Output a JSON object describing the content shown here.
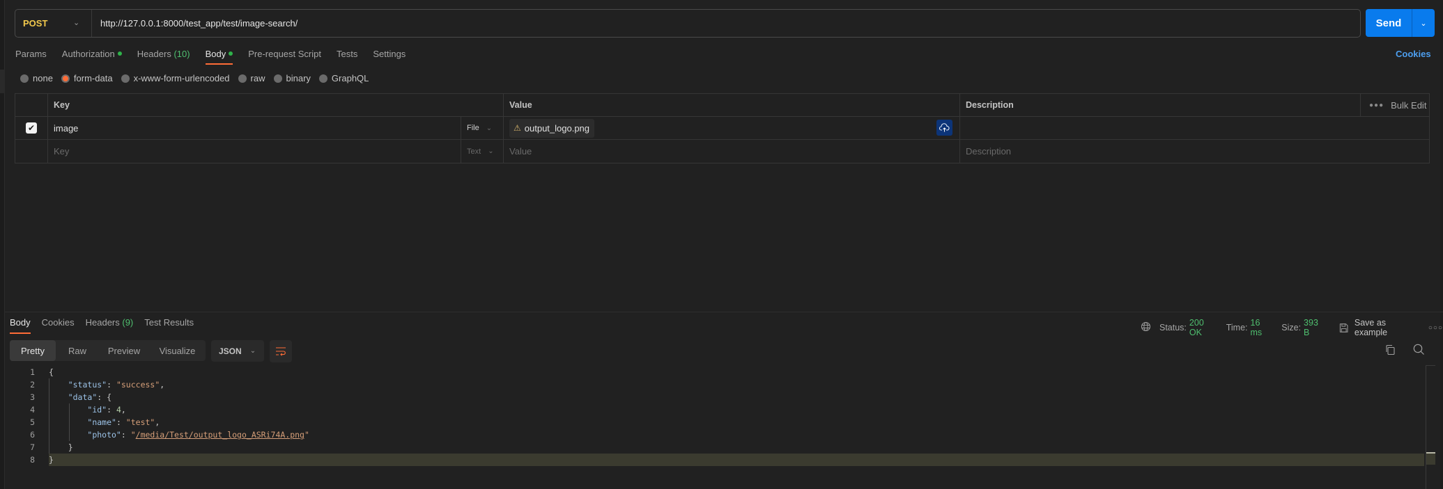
{
  "request": {
    "method": "POST",
    "url": "http://127.0.0.1:8000/test_app/test/image-search/",
    "send_label": "Send",
    "cookies_label": "Cookies"
  },
  "request_tabs": [
    {
      "label": "Params",
      "active": false
    },
    {
      "label": "Authorization",
      "dot": true,
      "active": false
    },
    {
      "label": "Headers",
      "count": "(10)",
      "active": false
    },
    {
      "label": "Body",
      "dot": true,
      "active": true
    },
    {
      "label": "Pre-request Script",
      "active": false
    },
    {
      "label": "Tests",
      "active": false
    },
    {
      "label": "Settings",
      "active": false
    }
  ],
  "body_types": [
    {
      "label": "none",
      "selected": false
    },
    {
      "label": "form-data",
      "selected": true
    },
    {
      "label": "x-www-form-urlencoded",
      "selected": false
    },
    {
      "label": "raw",
      "selected": false
    },
    {
      "label": "binary",
      "selected": false
    },
    {
      "label": "GraphQL",
      "selected": false
    }
  ],
  "form_table": {
    "headers": {
      "key": "Key",
      "value": "Value",
      "description": "Description",
      "bulk_edit": "Bulk Edit"
    },
    "rows": [
      {
        "checked": true,
        "key": "image",
        "type": "File",
        "value": "output_logo.png",
        "description": ""
      }
    ],
    "placeholder_row": {
      "key": "Key",
      "type": "Text",
      "value": "Value",
      "description": "Description"
    }
  },
  "response": {
    "tabs": [
      {
        "label": "Body",
        "active": true
      },
      {
        "label": "Cookies",
        "active": false
      },
      {
        "label": "Headers",
        "count": "(9)",
        "active": false
      },
      {
        "label": "Test Results",
        "active": false
      }
    ],
    "status_label": "Status:",
    "status": "200 OK",
    "time_label": "Time:",
    "time": "16 ms",
    "size_label": "Size:",
    "size": "393 B",
    "save_label": "Save as example",
    "modes": [
      {
        "label": "Pretty",
        "active": true
      },
      {
        "label": "Raw",
        "active": false
      },
      {
        "label": "Preview",
        "active": false
      },
      {
        "label": "Visualize",
        "active": false
      }
    ],
    "format": "JSON",
    "line_numbers": [
      "1",
      "2",
      "3",
      "4",
      "5",
      "6",
      "7",
      "8"
    ],
    "body": {
      "status_key": "\"status\"",
      "status_value": "\"success\"",
      "data_key": "\"data\"",
      "id_key": "\"id\"",
      "id_value": "4",
      "name_key": "\"name\"",
      "name_value": "\"test\"",
      "photo_key": "\"photo\"",
      "photo_value": "/media/Test/output_logo_ASRi74A.png"
    }
  },
  "colors": {
    "accent": "#ff6c37",
    "send": "#097bed",
    "success": "#4fbf6f",
    "method": "#f2c94c",
    "link": "#4d9ff0"
  }
}
